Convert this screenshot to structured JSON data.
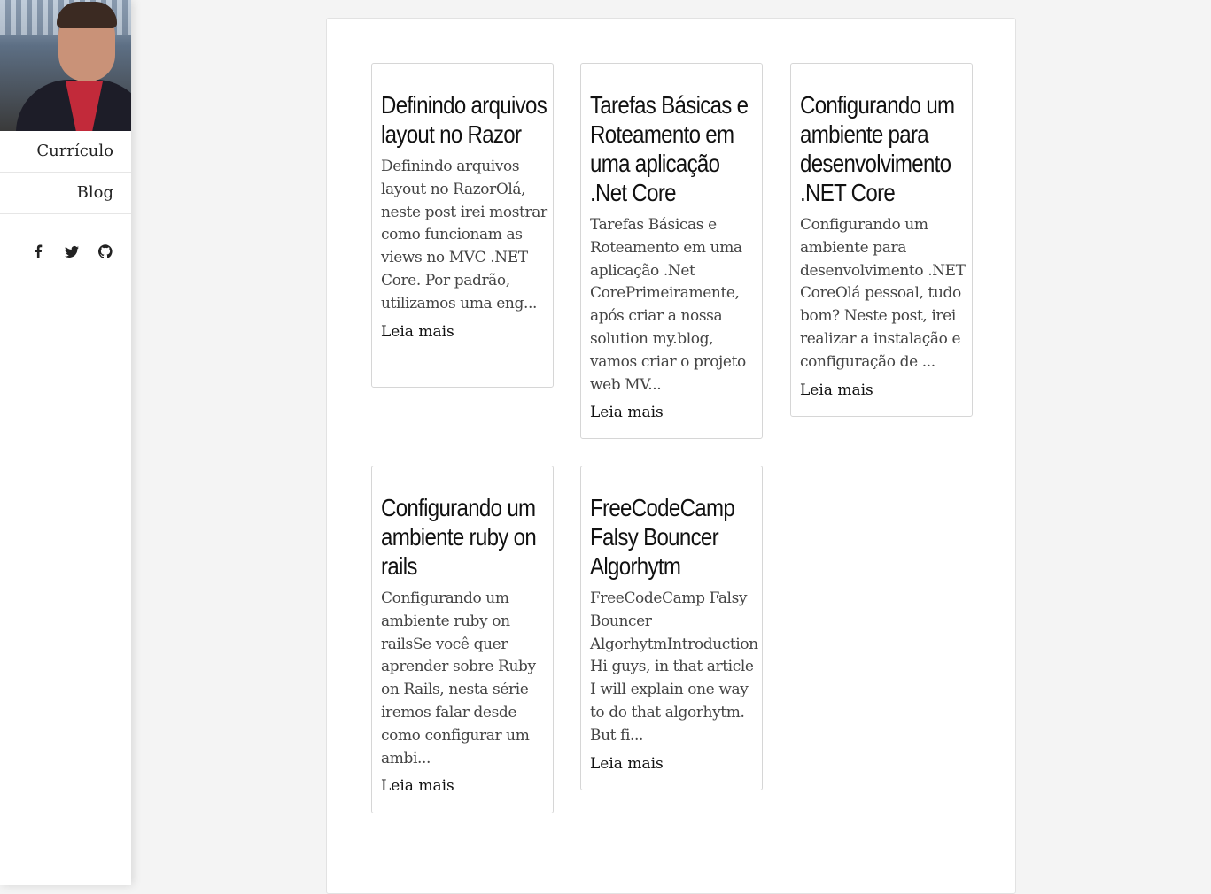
{
  "sidebar": {
    "nav": [
      {
        "label": "Currículo"
      },
      {
        "label": "Blog"
      }
    ],
    "social": [
      "facebook-icon",
      "twitter-icon",
      "github-icon"
    ]
  },
  "posts": [
    {
      "title": "Definindo arquivos layout no Razor",
      "excerpt": "Definindo arquivos layout no RazorOlá, neste post irei mostrar como funcionam as views no MVC .NET Core. Por padrão, utilizamos uma eng...",
      "more": "Leia mais"
    },
    {
      "title": "Tarefas Básicas e Roteamento em uma aplicação .Net Core",
      "excerpt": "Tarefas Básicas e Roteamento em uma aplicação .Net CorePrimeiramente, após criar a nossa solution my.blog, vamos criar o projeto web MV...",
      "more": "Leia mais"
    },
    {
      "title": "Configurando um ambiente para desenvolvimento .NET Core",
      "excerpt": "Configurando um ambiente para desenvolvimento .NET CoreOlá pessoal, tudo bom? Neste post, irei realizar a instalação e configuração de ...",
      "more": "Leia mais"
    },
    {
      "title": "Configurando um ambiente ruby on rails",
      "excerpt": "Configurando um ambiente ruby on railsSe você quer aprender sobre Ruby on Rails, nesta série iremos falar desde como configurar um ambi...",
      "more": "Leia mais"
    },
    {
      "title": "FreeCodeCamp Falsy Bouncer Algorhytm",
      "excerpt": "FreeCodeCamp Falsy Bouncer AlgorhytmIntroduction Hi guys, in that article I will explain one way to do that algorhytm. But fi...",
      "more": "Leia mais"
    }
  ]
}
